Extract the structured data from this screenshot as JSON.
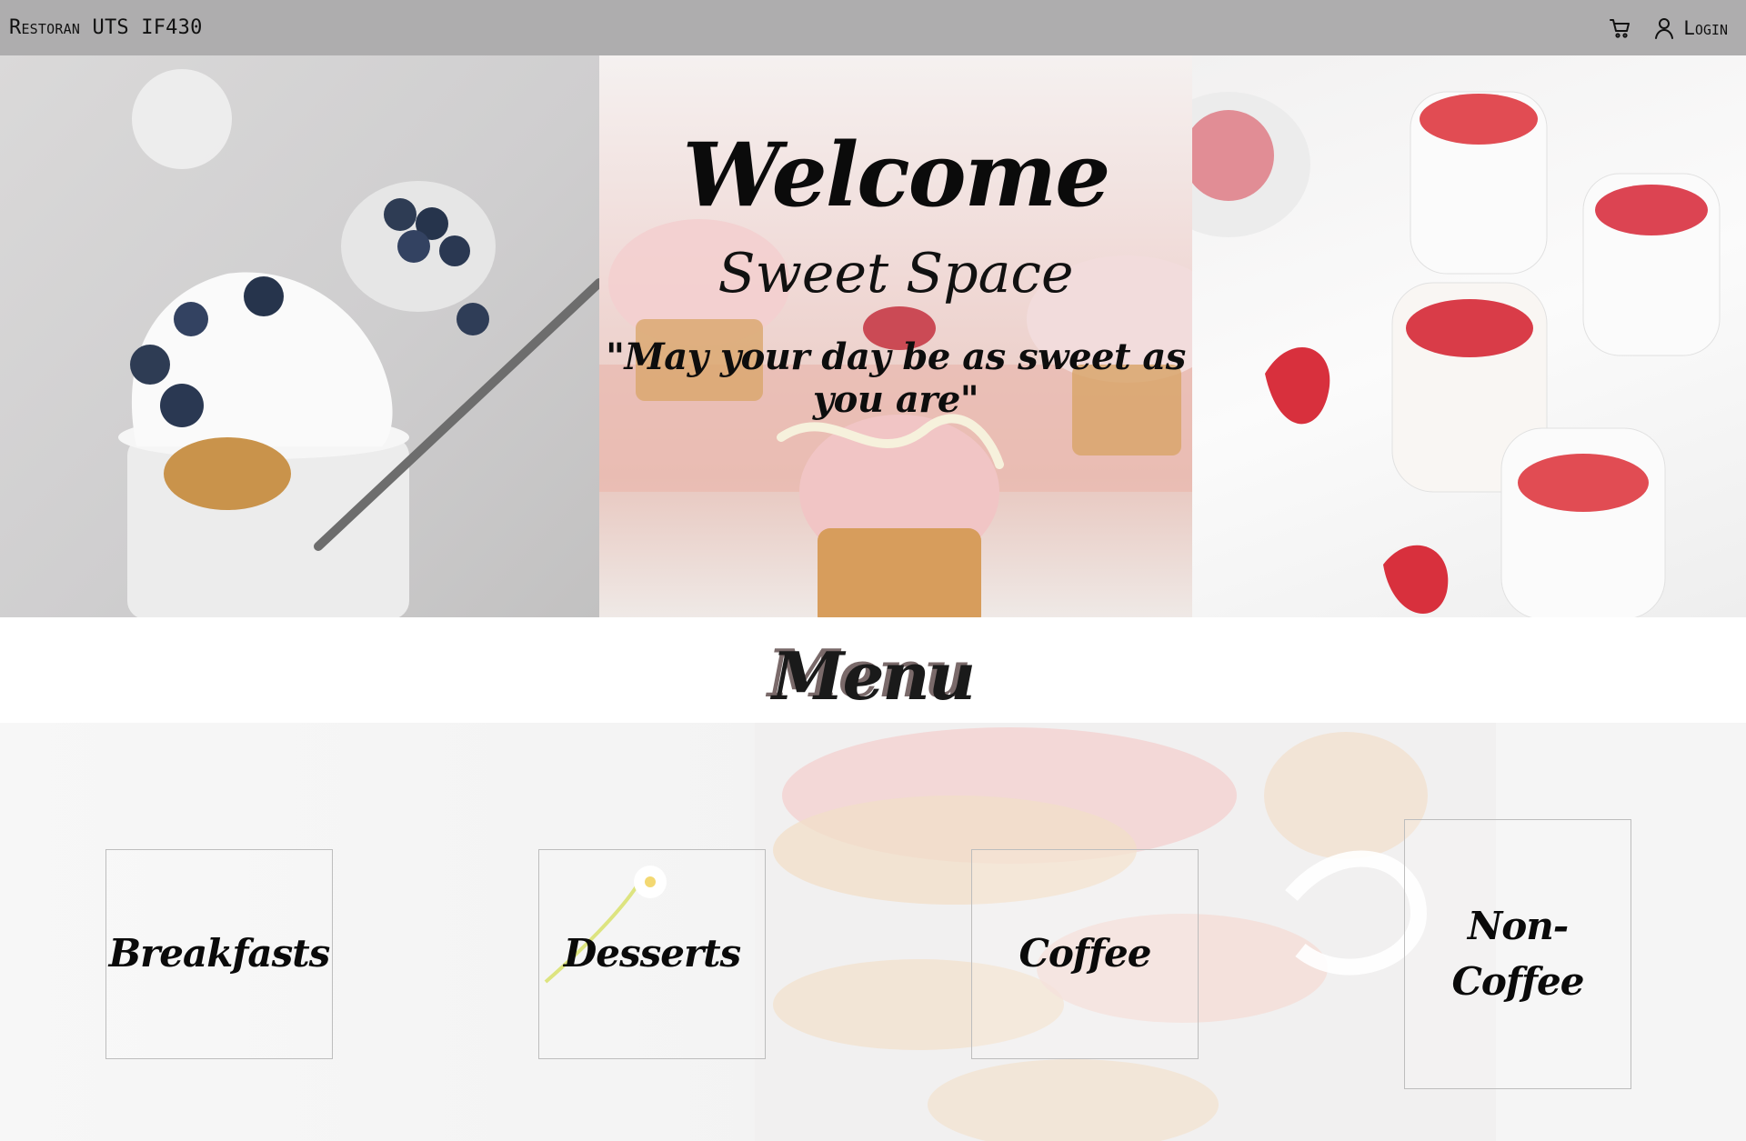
{
  "navbar": {
    "brand": "Restoran UTS IF430",
    "cart_icon": "shopping-cart-icon",
    "user_icon": "user-icon",
    "login_label": "Login"
  },
  "hero": {
    "title": "Welcome",
    "subtitle": "Sweet Space",
    "tagline": "\"May your day be as sweet as you are\""
  },
  "menu": {
    "heading": "Menu",
    "categories": [
      {
        "label": "Breakfasts"
      },
      {
        "label": "Desserts"
      },
      {
        "label": "Coffee"
      },
      {
        "label": "Non-Coffee"
      }
    ]
  }
}
